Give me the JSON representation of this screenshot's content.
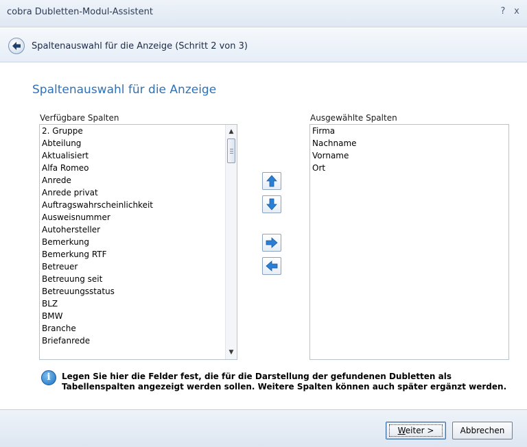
{
  "window": {
    "title": "cobra Dubletten-Modul-Assistent",
    "help_glyph": "?",
    "close_glyph": "x"
  },
  "header": {
    "back_icon": "arrow-left-icon",
    "step_text": "Spaltenauswahl für die Anzeige (Schritt 2 von 3)"
  },
  "main": {
    "heading": "Spaltenauswahl für die Anzeige",
    "available": {
      "label": "Verfügbare Spalten",
      "items": [
        "2. Gruppe",
        "Abteilung",
        "Aktualisiert",
        "Alfa Romeo",
        "Anrede",
        "Anrede privat",
        "Auftragswahrscheinlichkeit",
        "Ausweisnummer",
        "Autohersteller",
        "Bemerkung",
        "Bemerkung RTF",
        "Betreuer",
        "Betreuung seit",
        "Betreuungsstatus",
        "BLZ",
        "BMW",
        "Branche",
        "Briefanrede"
      ]
    },
    "selected": {
      "label": "Ausgewählte Spalten",
      "items": [
        "Firma",
        "Nachname",
        "Vorname",
        "Ort"
      ]
    },
    "buttons": {
      "move_up_icon": "arrow-up-icon",
      "move_down_icon": "arrow-down-icon",
      "add_icon": "arrow-right-icon",
      "remove_icon": "arrow-left-icon"
    },
    "info": {
      "icon": "info-icon",
      "line1": "Legen Sie hier die Felder fest, die für die Darstellung der gefundenen Dubletten als",
      "line2": "Tabellenspalten angezeigt werden sollen. Weitere Spalten können auch später ergänzt werden."
    }
  },
  "footer": {
    "next_label": "Weiter >",
    "cancel_label": "Abbrechen"
  },
  "colors": {
    "heading": "#2d72b8",
    "arrow_blue": "#2a7fd4",
    "frame": "#dfe8f3"
  }
}
